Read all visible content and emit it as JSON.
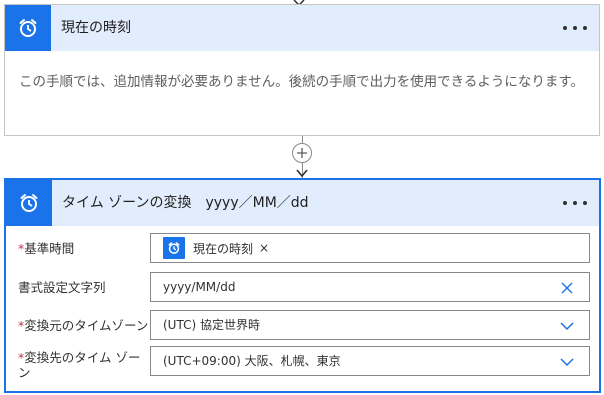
{
  "card1": {
    "title": "現在の時刻",
    "icon": "alarm-clock-icon",
    "description": "この手順では、追加情報が必要ありません。後続の手順で出力を使用できるようになります。"
  },
  "card2": {
    "title": "タイム ゾーンの変換　yyyy／MM／dd",
    "icon": "alarm-clock-icon",
    "fields": {
      "base_time": {
        "required_mark": "*",
        "label": "基準時間",
        "token_label": "現在の時刻",
        "token_remove": "×"
      },
      "format_string": {
        "label": "書式設定文字列",
        "value": "yyyy/MM/dd"
      },
      "source_timezone": {
        "required_mark": "*",
        "label": "変換元のタイムゾーン",
        "value": "(UTC) 協定世界時"
      },
      "target_timezone": {
        "required_mark": "*",
        "label_line1": "変換先のタイム ゾー",
        "label_line2": "ン",
        "value": "(UTC+09:00) 大阪、札幌、東京"
      }
    }
  },
  "colors": {
    "accent": "#1a73e8",
    "header_bg": "#e1ecfd",
    "required": "#c4314b",
    "border": "#8a8886"
  }
}
